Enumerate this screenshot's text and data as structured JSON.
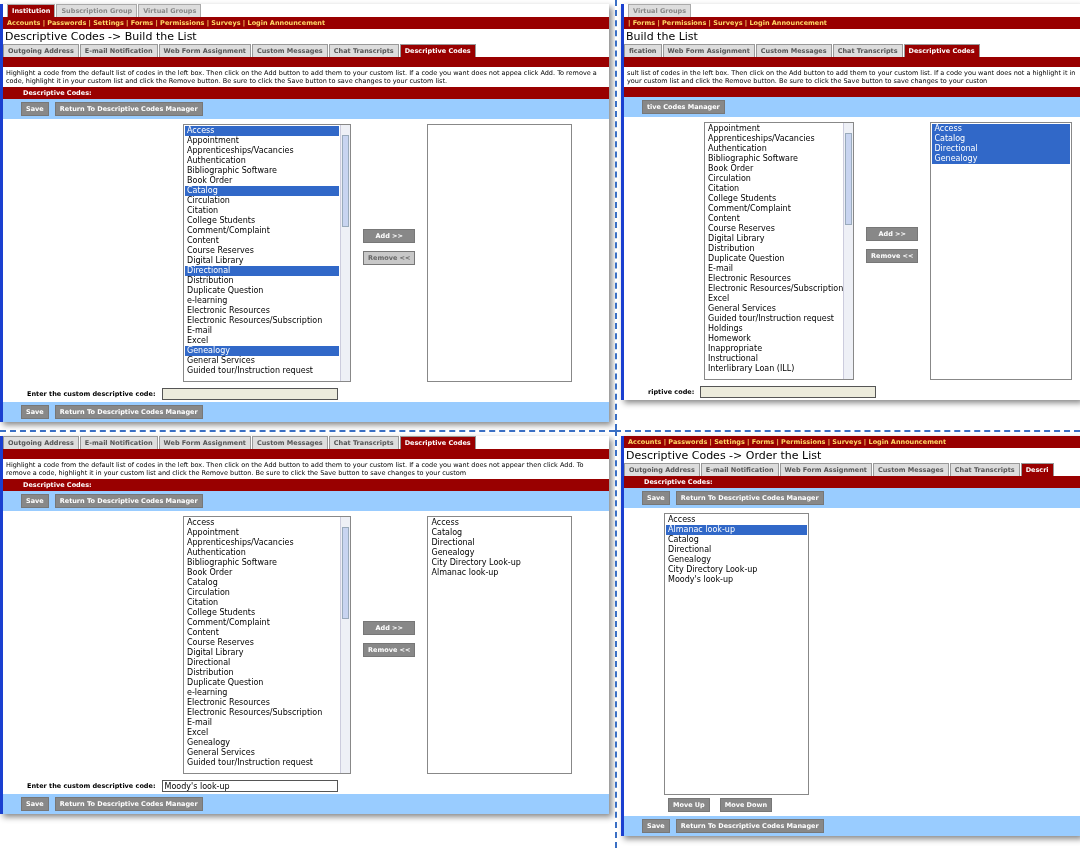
{
  "panels": [
    {
      "kind": "build",
      "top_tabs": [
        {
          "label": "Institution",
          "selected": true
        },
        {
          "label": "Subscription Group",
          "selected": false
        },
        {
          "label": "Virtual Groups",
          "selected": false
        }
      ],
      "nav": "Accounts | Passwords | Settings | Forms | Permissions | Surveys | Login Announcement",
      "heading": "Descriptive Codes -> Build the List",
      "tabs": [
        {
          "label": "Outgoing Address",
          "selected": false
        },
        {
          "label": "E-mail Notification",
          "selected": false
        },
        {
          "label": "Web Form Assignment",
          "selected": false
        },
        {
          "label": "Custom Messages",
          "selected": false
        },
        {
          "label": "Chat Transcripts",
          "selected": false
        },
        {
          "label": "Descriptive Codes",
          "selected": true
        }
      ],
      "instructions": "Highlight a code from the default list of codes in the left box. Then click on the Add button to add them to your custom list. If a code you want does not appea click Add. To remove a code, highlight it in your custom list and click the Remove button. Be sure to click the Save button to save changes to your custom list.",
      "section_title": "Descriptive Codes:",
      "toolbar": [
        "Save",
        "Return To Descriptive Codes Manager"
      ],
      "available": [
        {
          "label": "Access",
          "selected": true
        },
        {
          "label": "Appointment",
          "selected": false
        },
        {
          "label": "Apprenticeships/Vacancies",
          "selected": false
        },
        {
          "label": "Authentication",
          "selected": false
        },
        {
          "label": "Bibliographic Software",
          "selected": false
        },
        {
          "label": "Book Order",
          "selected": false
        },
        {
          "label": "Catalog",
          "selected": true
        },
        {
          "label": "Circulation",
          "selected": false
        },
        {
          "label": "Citation",
          "selected": false
        },
        {
          "label": "College Students",
          "selected": false
        },
        {
          "label": "Comment/Complaint",
          "selected": false
        },
        {
          "label": "Content",
          "selected": false
        },
        {
          "label": "Course Reserves",
          "selected": false
        },
        {
          "label": "Digital Library",
          "selected": false
        },
        {
          "label": "Directional",
          "selected": true
        },
        {
          "label": "Distribution",
          "selected": false
        },
        {
          "label": "Duplicate Question",
          "selected": false
        },
        {
          "label": "e-learning",
          "selected": false
        },
        {
          "label": "Electronic Resources",
          "selected": false
        },
        {
          "label": "Electronic Resources/Subscription",
          "selected": false
        },
        {
          "label": "E-mail",
          "selected": false
        },
        {
          "label": "Excel",
          "selected": false
        },
        {
          "label": "Genealogy",
          "selected": true
        },
        {
          "label": "General Services",
          "selected": false
        },
        {
          "label": "Guided tour/Instruction request",
          "selected": false
        }
      ],
      "add_button": {
        "label": "Add >>",
        "disabled": false
      },
      "remove_button": {
        "label": "Remove <<",
        "disabled": true
      },
      "custom_code": {
        "label": "Enter the custom descriptive code:"
      },
      "footer": [
        "Save",
        "Return To Descriptive Codes Manager"
      ]
    },
    {
      "kind": "build",
      "top_tabs": [
        {
          "label": "Virtual Groups",
          "selected": false
        }
      ],
      "nav": "| Forms | Permissions | Surveys | Login Announcement",
      "heading": "Build the List",
      "tabs": [
        {
          "label": "fication",
          "selected": false
        },
        {
          "label": "Web Form Assignment",
          "selected": false
        },
        {
          "label": "Custom Messages",
          "selected": false
        },
        {
          "label": "Chat Transcripts",
          "selected": false
        },
        {
          "label": "Descriptive Codes",
          "selected": true
        }
      ],
      "instructions": "sult list of codes in the left box. Then click on the Add button to add them to your custom list. If a code you want does not a highlight it in your custom list and click the Remove button. Be sure to click the Save button to save changes to your custon",
      "toolbar": [
        "tive Codes Manager"
      ],
      "available": [
        {
          "label": "Appointment",
          "selected": false
        },
        {
          "label": "Apprenticeships/Vacancies",
          "selected": false
        },
        {
          "label": "Authentication",
          "selected": false
        },
        {
          "label": "Bibliographic Software",
          "selected": false
        },
        {
          "label": "Book Order",
          "selected": false
        },
        {
          "label": "Circulation",
          "selected": false
        },
        {
          "label": "Citation",
          "selected": false
        },
        {
          "label": "College Students",
          "selected": false
        },
        {
          "label": "Comment/Complaint",
          "selected": false
        },
        {
          "label": "Content",
          "selected": false
        },
        {
          "label": "Course Reserves",
          "selected": false
        },
        {
          "label": "Digital Library",
          "selected": false
        },
        {
          "label": "Distribution",
          "selected": false
        },
        {
          "label": "Duplicate Question",
          "selected": false
        },
        {
          "label": "E-mail",
          "selected": false
        },
        {
          "label": "Electronic Resources",
          "selected": false
        },
        {
          "label": "Electronic Resources/Subscription",
          "selected": false
        },
        {
          "label": "Excel",
          "selected": false
        },
        {
          "label": "General Services",
          "selected": false
        },
        {
          "label": "Guided tour/Instruction request",
          "selected": false
        },
        {
          "label": "Holdings",
          "selected": false
        },
        {
          "label": "Homework",
          "selected": false
        },
        {
          "label": "Inappropriate",
          "selected": false
        },
        {
          "label": "Instructional",
          "selected": false
        },
        {
          "label": "Interlibrary Loan (ILL)",
          "selected": false
        }
      ],
      "add_button": {
        "label": "Add >>",
        "disabled": false
      },
      "remove_button": {
        "label": "Remove <<",
        "disabled": false
      },
      "custom_list": [
        {
          "label": "Access",
          "selected": true
        },
        {
          "label": "Catalog",
          "selected": true
        },
        {
          "label": "Directional",
          "selected": true
        },
        {
          "label": "Genealogy",
          "selected": true
        }
      ],
      "custom_code": {
        "label": "riptive code:"
      }
    },
    {
      "kind": "build",
      "tabs": [
        {
          "label": "Outgoing Address",
          "selected": false
        },
        {
          "label": "E-mail Notification",
          "selected": false
        },
        {
          "label": "Web Form Assignment",
          "selected": false
        },
        {
          "label": "Custom Messages",
          "selected": false
        },
        {
          "label": "Chat Transcripts",
          "selected": false
        },
        {
          "label": "Descriptive Codes",
          "selected": true
        }
      ],
      "instructions": "Highlight a code from the default list of codes in the left box. Then click on the Add button to add them to your custom list. If a code you want does not appear then click Add. To remove a code, highlight it in your custom list and click the Remove button. Be sure to click the Save button to save changes to your custom",
      "section_title": "Descriptive Codes:",
      "toolbar": [
        "Save",
        "Return To Descriptive Codes Manager"
      ],
      "available": [
        {
          "label": "Access",
          "selected": false
        },
        {
          "label": "Appointment",
          "selected": false
        },
        {
          "label": "Apprenticeships/Vacancies",
          "selected": false
        },
        {
          "label": "Authentication",
          "selected": false
        },
        {
          "label": "Bibliographic Software",
          "selected": false
        },
        {
          "label": "Book Order",
          "selected": false
        },
        {
          "label": "Catalog",
          "selected": false
        },
        {
          "label": "Circulation",
          "selected": false
        },
        {
          "label": "Citation",
          "selected": false
        },
        {
          "label": "College Students",
          "selected": false
        },
        {
          "label": "Comment/Complaint",
          "selected": false
        },
        {
          "label": "Content",
          "selected": false
        },
        {
          "label": "Course Reserves",
          "selected": false
        },
        {
          "label": "Digital Library",
          "selected": false
        },
        {
          "label": "Directional",
          "selected": false
        },
        {
          "label": "Distribution",
          "selected": false
        },
        {
          "label": "Duplicate Question",
          "selected": false
        },
        {
          "label": "e-learning",
          "selected": false
        },
        {
          "label": "Electronic Resources",
          "selected": false
        },
        {
          "label": "Electronic Resources/Subscription",
          "selected": false
        },
        {
          "label": "E-mail",
          "selected": false
        },
        {
          "label": "Excel",
          "selected": false
        },
        {
          "label": "Genealogy",
          "selected": false
        },
        {
          "label": "General Services",
          "selected": false
        },
        {
          "label": "Guided tour/Instruction request",
          "selected": false
        }
      ],
      "add_button": {
        "label": "Add >>",
        "disabled": false
      },
      "remove_button": {
        "label": "Remove <<",
        "disabled": false
      },
      "custom_list": [
        {
          "label": "Access",
          "selected": false
        },
        {
          "label": "Catalog",
          "selected": false
        },
        {
          "label": "Directional",
          "selected": false
        },
        {
          "label": "Genealogy",
          "selected": false
        },
        {
          "label": "City Directory Look-up",
          "selected": false
        },
        {
          "label": "Almanac look-up",
          "selected": false
        }
      ],
      "custom_code": {
        "label": "Enter the custom descriptive code:",
        "value": "Moody's look-up"
      },
      "footer": [
        "Save",
        "Return To Descriptive Codes Manager"
      ]
    },
    {
      "kind": "order",
      "nav": "Accounts | Passwords | Settings | Forms | Permissions | Surveys | Login Announcement",
      "heading": "Descriptive Codes -> Order the List",
      "tabs": [
        {
          "label": "Outgoing Address",
          "selected": false
        },
        {
          "label": "E-mail Notification",
          "selected": false
        },
        {
          "label": "Web Form Assignment",
          "selected": false
        },
        {
          "label": "Custom Messages",
          "selected": false
        },
        {
          "label": "Chat Transcripts",
          "selected": false
        },
        {
          "label": "Descri",
          "selected": true
        }
      ],
      "section_title": "Descriptive Codes:",
      "toolbar": [
        "Save",
        "Return To Descriptive Codes Manager"
      ],
      "order_list": [
        {
          "label": "Access",
          "selected": false
        },
        {
          "label": "Almanac look-up",
          "selected": true
        },
        {
          "label": "Catalog",
          "selected": false
        },
        {
          "label": "Directional",
          "selected": false
        },
        {
          "label": "Genealogy",
          "selected": false
        },
        {
          "label": "City Directory Look-up",
          "selected": false
        },
        {
          "label": "Moody's look-up",
          "selected": false
        }
      ],
      "move_buttons": [
        "Move Up",
        "Move Down"
      ],
      "footer": [
        "Save",
        "Return To Descriptive Codes Manager"
      ]
    }
  ]
}
